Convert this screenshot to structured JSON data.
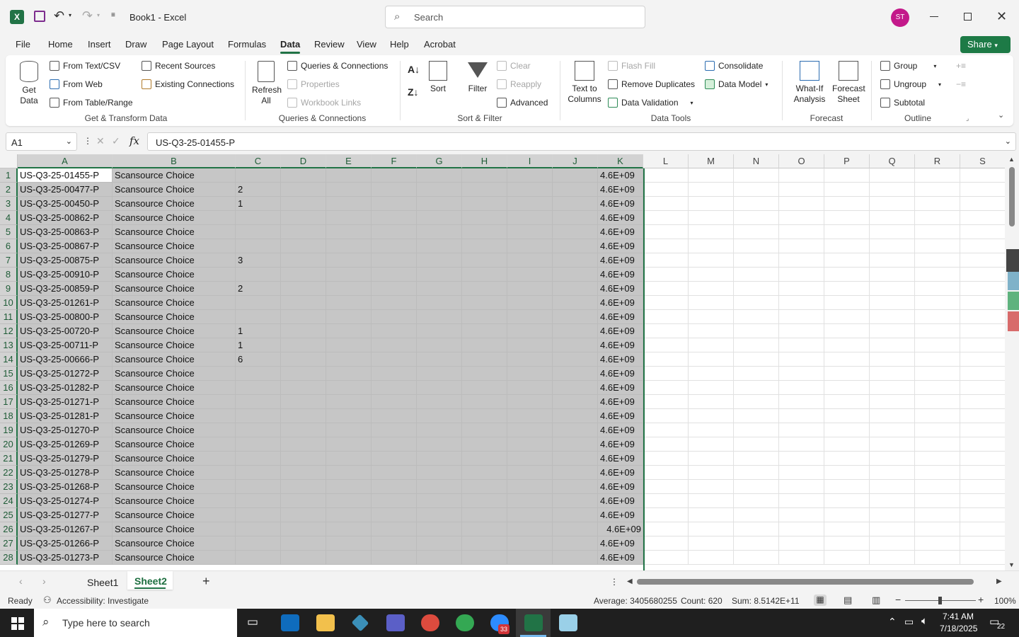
{
  "app": {
    "title": "Book1  -  Excel",
    "search_placeholder": "Search",
    "user_initials": "ST",
    "share": "Share"
  },
  "tabs": [
    "File",
    "Home",
    "Insert",
    "Draw",
    "Page Layout",
    "Formulas",
    "Data",
    "Review",
    "View",
    "Help",
    "Acrobat"
  ],
  "ribbon": {
    "get_data": "Get Data",
    "from_text": "From Text/CSV",
    "from_web": "From Web",
    "from_table": "From Table/Range",
    "recent_sources": "Recent Sources",
    "existing_connections": "Existing Connections",
    "grp_get": "Get & Transform Data",
    "refresh_all": "Refresh All",
    "queries": "Queries & Connections",
    "properties": "Properties",
    "workbook_links": "Workbook Links",
    "grp_queries": "Queries & Connections",
    "sort": "Sort",
    "filter": "Filter",
    "clear": "Clear",
    "reapply": "Reapply",
    "advanced": "Advanced",
    "grp_sort": "Sort & Filter",
    "text_to_columns": "Text to Columns",
    "flash_fill": "Flash Fill",
    "remove_duplicates": "Remove Duplicates",
    "data_validation": "Data Validation",
    "consolidate": "Consolidate",
    "data_model": "Data Model",
    "grp_tools": "Data Tools",
    "what_if": "What-If Analysis",
    "forecast_sheet": "Forecast Sheet",
    "grp_forecast": "Forecast",
    "group": "Group",
    "ungroup": "Ungroup",
    "subtotal": "Subtotal",
    "grp_outline": "Outline"
  },
  "formula_bar": {
    "name_box": "A1",
    "fx": "fx",
    "content": "US-Q3-25-01455-P"
  },
  "columns": [
    "A",
    "B",
    "C",
    "D",
    "E",
    "F",
    "G",
    "H",
    "I",
    "J",
    "K",
    "L",
    "M",
    "N",
    "O",
    "P",
    "Q",
    "R",
    "S"
  ],
  "rows": [
    {
      "n": "1",
      "a": "US-Q3-25-01455-P",
      "b": "Scansource Choice",
      "c": "",
      "k": "4.6E+09"
    },
    {
      "n": "2",
      "a": "US-Q3-25-00477-P",
      "b": "Scansource Choice",
      "c": "2",
      "k": "4.6E+09"
    },
    {
      "n": "3",
      "a": "US-Q3-25-00450-P",
      "b": "Scansource Choice",
      "c": "1",
      "k": "4.6E+09"
    },
    {
      "n": "4",
      "a": "US-Q3-25-00862-P",
      "b": "Scansource Choice",
      "c": "",
      "k": "4.6E+09"
    },
    {
      "n": "5",
      "a": "US-Q3-25-00863-P",
      "b": "Scansource Choice",
      "c": "",
      "k": "4.6E+09"
    },
    {
      "n": "6",
      "a": "US-Q3-25-00867-P",
      "b": "Scansource Choice",
      "c": "",
      "k": "4.6E+09"
    },
    {
      "n": "7",
      "a": "US-Q3-25-00875-P",
      "b": "Scansource Choice",
      "c": "3",
      "k": "4.6E+09"
    },
    {
      "n": "8",
      "a": "US-Q3-25-00910-P",
      "b": "Scansource Choice",
      "c": "",
      "k": "4.6E+09"
    },
    {
      "n": "9",
      "a": "US-Q3-25-00859-P",
      "b": "Scansource Choice",
      "c": "2",
      "k": "4.6E+09"
    },
    {
      "n": "10",
      "a": "US-Q3-25-01261-P",
      "b": "Scansource Choice",
      "c": "",
      "k": "4.6E+09"
    },
    {
      "n": "11",
      "a": "US-Q3-25-00800-P",
      "b": "Scansource Choice",
      "c": "",
      "k": "4.6E+09"
    },
    {
      "n": "12",
      "a": "US-Q3-25-00720-P",
      "b": "Scansource Choice",
      "c": "1",
      "k": "4.6E+09"
    },
    {
      "n": "13",
      "a": "US-Q3-25-00711-P",
      "b": "Scansource Choice",
      "c": "1",
      "k": "4.6E+09"
    },
    {
      "n": "14",
      "a": "US-Q3-25-00666-P",
      "b": "Scansource Choice",
      "c": "6",
      "k": "4.6E+09"
    },
    {
      "n": "15",
      "a": "US-Q3-25-01272-P",
      "b": "Scansource Choice",
      "c": "",
      "k": "4.6E+09"
    },
    {
      "n": "16",
      "a": "US-Q3-25-01282-P",
      "b": "Scansource Choice",
      "c": "",
      "k": "4.6E+09"
    },
    {
      "n": "17",
      "a": "US-Q3-25-01271-P",
      "b": "Scansource Choice",
      "c": "",
      "k": "4.6E+09"
    },
    {
      "n": "18",
      "a": "US-Q3-25-01281-P",
      "b": "Scansource Choice",
      "c": "",
      "k": "4.6E+09"
    },
    {
      "n": "19",
      "a": "US-Q3-25-01270-P",
      "b": "Scansource Choice",
      "c": "",
      "k": "4.6E+09"
    },
    {
      "n": "20",
      "a": "US-Q3-25-01269-P",
      "b": "Scansource Choice",
      "c": "",
      "k": "4.6E+09"
    },
    {
      "n": "21",
      "a": "US-Q3-25-01279-P",
      "b": "Scansource Choice",
      "c": "",
      "k": "4.6E+09"
    },
    {
      "n": "22",
      "a": "US-Q3-25-01278-P",
      "b": "Scansource Choice",
      "c": "",
      "k": "4.6E+09"
    },
    {
      "n": "23",
      "a": "US-Q3-25-01268-P",
      "b": "Scansource Choice",
      "c": "",
      "k": "4.6E+09"
    },
    {
      "n": "24",
      "a": "US-Q3-25-01274-P",
      "b": "Scansource Choice",
      "c": "",
      "k": "4.6E+09"
    },
    {
      "n": "25",
      "a": "US-Q3-25-01277-P",
      "b": "Scansource Choice",
      "c": "",
      "k": "4.6E+09"
    },
    {
      "n": "26",
      "a": "US-Q3-25-01267-P",
      "b": "Scansource Choice",
      "c": "",
      "k": "4.6E+09"
    },
    {
      "n": "27",
      "a": "US-Q3-25-01266-P",
      "b": "Scansource Choice",
      "c": "",
      "k": "4.6E+09"
    },
    {
      "n": "28",
      "a": "US-Q3-25-01273-P",
      "b": "Scansource Choice",
      "c": "",
      "k": "4.6E+09"
    }
  ],
  "sheets": [
    "Sheet1",
    "Sheet2"
  ],
  "status": {
    "ready": "Ready",
    "accessibility": "Accessibility: Investigate",
    "average": "Average: 3405680255",
    "count": "Count: 620",
    "sum": "Sum: 8.5142E+11",
    "zoom": "100%"
  },
  "taskbar": {
    "search": "Type here to search",
    "time": "7:41 AM",
    "date": "7/18/2025",
    "notif": "22",
    "zoom_badge": "33"
  },
  "colors": {
    "excel_green": "#217346",
    "share_green": "#1d7a46",
    "avatar": "#c3198a"
  }
}
